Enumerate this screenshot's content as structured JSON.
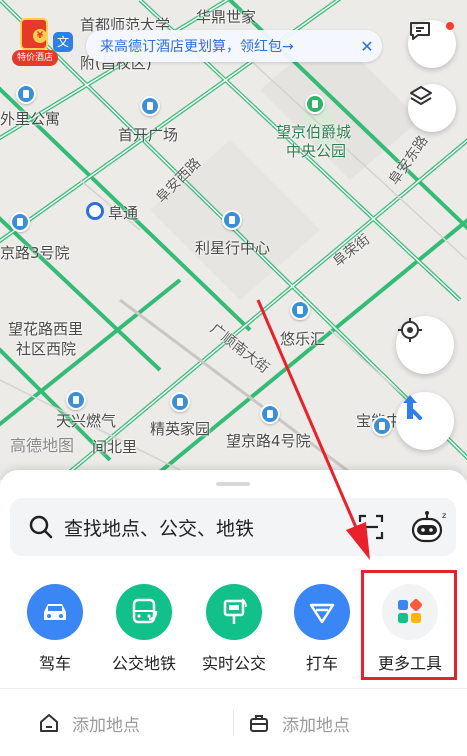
{
  "banner": {
    "text": "来高德订酒店更划算，领红包→",
    "close": "✕"
  },
  "hongbao": {
    "coin": "¥",
    "tag": "特价酒店"
  },
  "badge": {
    "text": "文"
  },
  "map": {
    "labels": {
      "huaxing": "华鼎世家",
      "capital": "首都师范大学",
      "capital2": "附(昌校区)",
      "waili": "外里公寓",
      "shoukai": "首开广场",
      "wangjing_park1": "望京伯爵城",
      "wangjing_park2": "中央公园",
      "fuan_east": "阜安东路",
      "fuan_west": "阜安西路",
      "futong": "阜通",
      "lixing": "利星行中心",
      "fuan_st": "阜荣街",
      "jingroad3": "京路3号院",
      "wanghua1": "望花路西里",
      "wanghua2": "社区西院",
      "guangshun": "广顺南大街",
      "youle": "悠乐汇",
      "tianxing": "天兴燃气",
      "jianbei": "间北里",
      "jingying": "精英家园",
      "wangjing4": "望京路4号院",
      "baoneng": "宝能中",
      "watermark": "高德地图"
    }
  },
  "search": {
    "placeholder": "查找地点、公交、地铁"
  },
  "tools": [
    {
      "label": "驾车",
      "color": "#3b86f5"
    },
    {
      "label": "公交地铁",
      "color": "#12c08a"
    },
    {
      "label": "实时公交",
      "color": "#12c08a"
    },
    {
      "label": "打车",
      "color": "#3b86f5"
    },
    {
      "label": "更多工具",
      "color": "#f2f3f5"
    }
  ],
  "bottom": {
    "home": "添加地点",
    "work": "添加地点"
  },
  "colors": {
    "accent": "#e8212b",
    "road": "#21b86a"
  }
}
